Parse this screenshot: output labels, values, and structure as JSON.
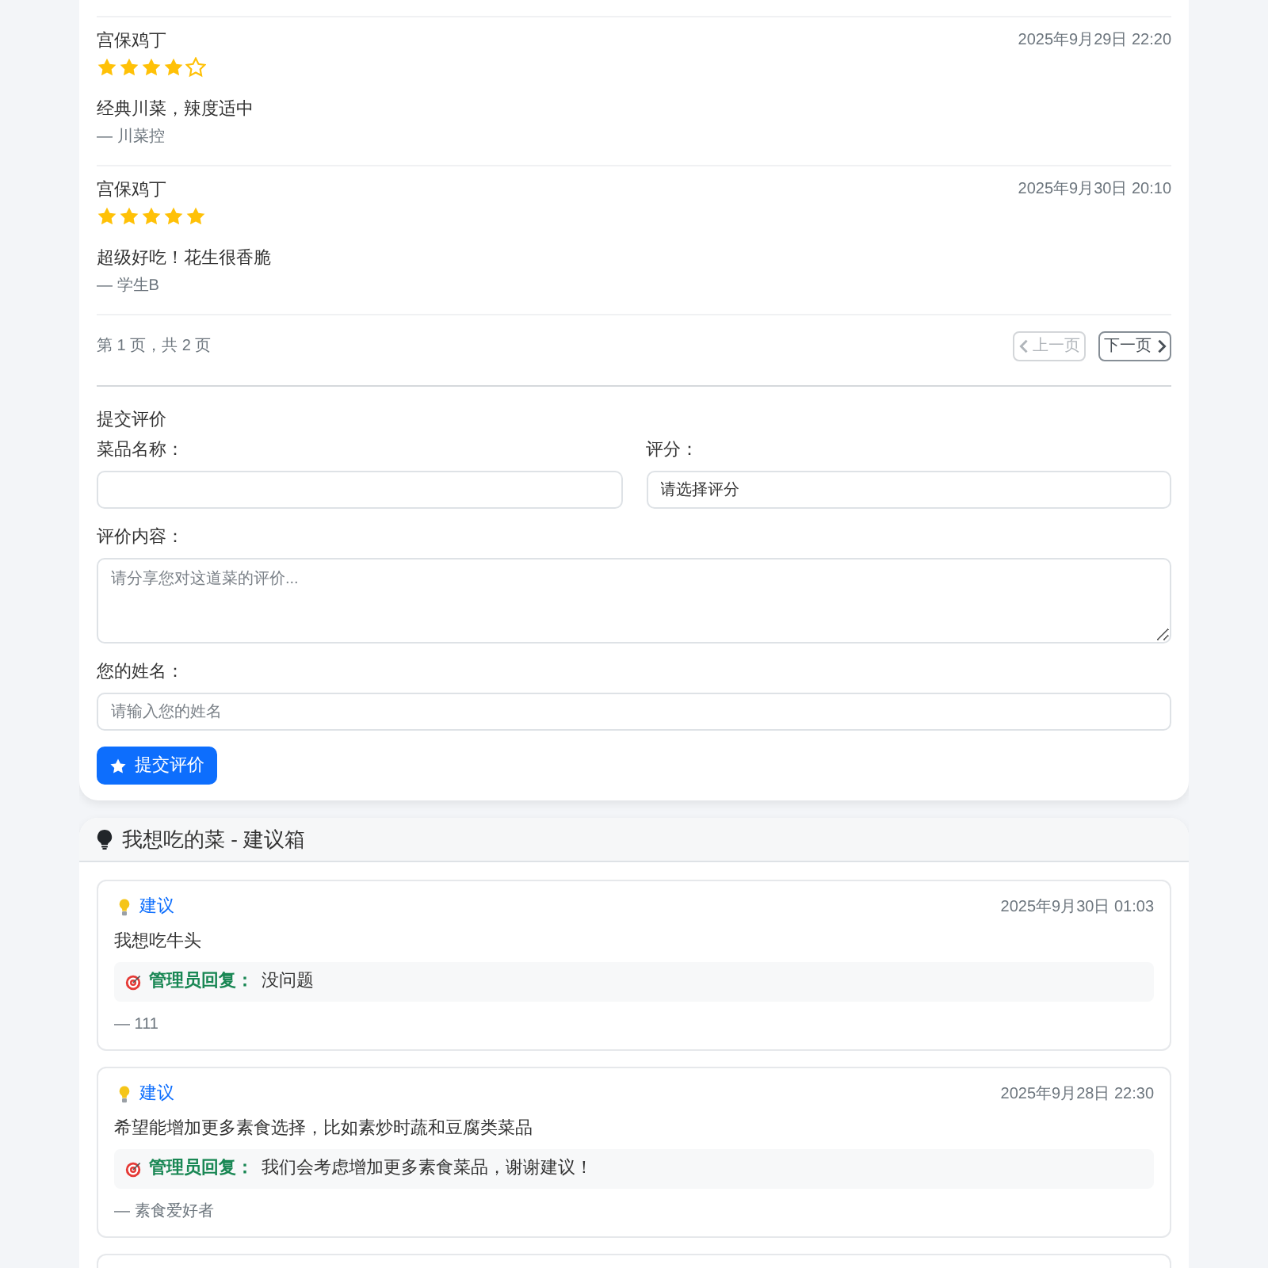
{
  "reviews": [
    {
      "dish": "宫保鸡丁",
      "date": "2025年9月29日 22:20",
      "stars": 4,
      "comment": "经典川菜，辣度适中",
      "author": "— 川菜控"
    },
    {
      "dish": "宫保鸡丁",
      "date": "2025年9月30日 20:10",
      "stars": 5,
      "comment": "超级好吃！花生很香脆",
      "author": "— 学生B"
    }
  ],
  "pagination": {
    "info": "第 1 页，共 2 页",
    "buttons": [
      {
        "kind": "prev",
        "label": "上一页",
        "disabled": true
      },
      {
        "kind": "next",
        "label": "下一页",
        "disabled": false
      }
    ]
  },
  "review_form": {
    "title": "提交评价",
    "rows": [
      [
        {
          "kind": "text",
          "label": "菜品名称："
        },
        {
          "kind": "select",
          "label": "评分：",
          "value": "请选择评分"
        }
      ],
      [
        {
          "kind": "textarea",
          "label": "评价内容：",
          "placeholder": "请分享您对这道菜的评价..."
        }
      ],
      [
        {
          "kind": "text",
          "label": "您的姓名：",
          "placeholder": "请输入您的姓名"
        }
      ]
    ],
    "submit_button": "提交评价"
  },
  "suggestion_box": {
    "title": "我想吃的菜 - 建议箱",
    "suggestions": [
      {
        "tag": "建议",
        "date": "2025年9月30日 01:03",
        "content": "我想吃牛头",
        "reply_label": "管理员回复：",
        "reply": "没问题",
        "author": "— 111"
      },
      {
        "tag": "建议",
        "date": "2025年9月28日 22:30",
        "content": "希望能增加更多素食选择，比如素炒时蔬和豆腐类菜品",
        "reply_label": "管理员回复：",
        "reply": "我们会考虑增加更多素食菜品，谢谢建议！",
        "author": "— 素食爱好者"
      }
    ]
  }
}
